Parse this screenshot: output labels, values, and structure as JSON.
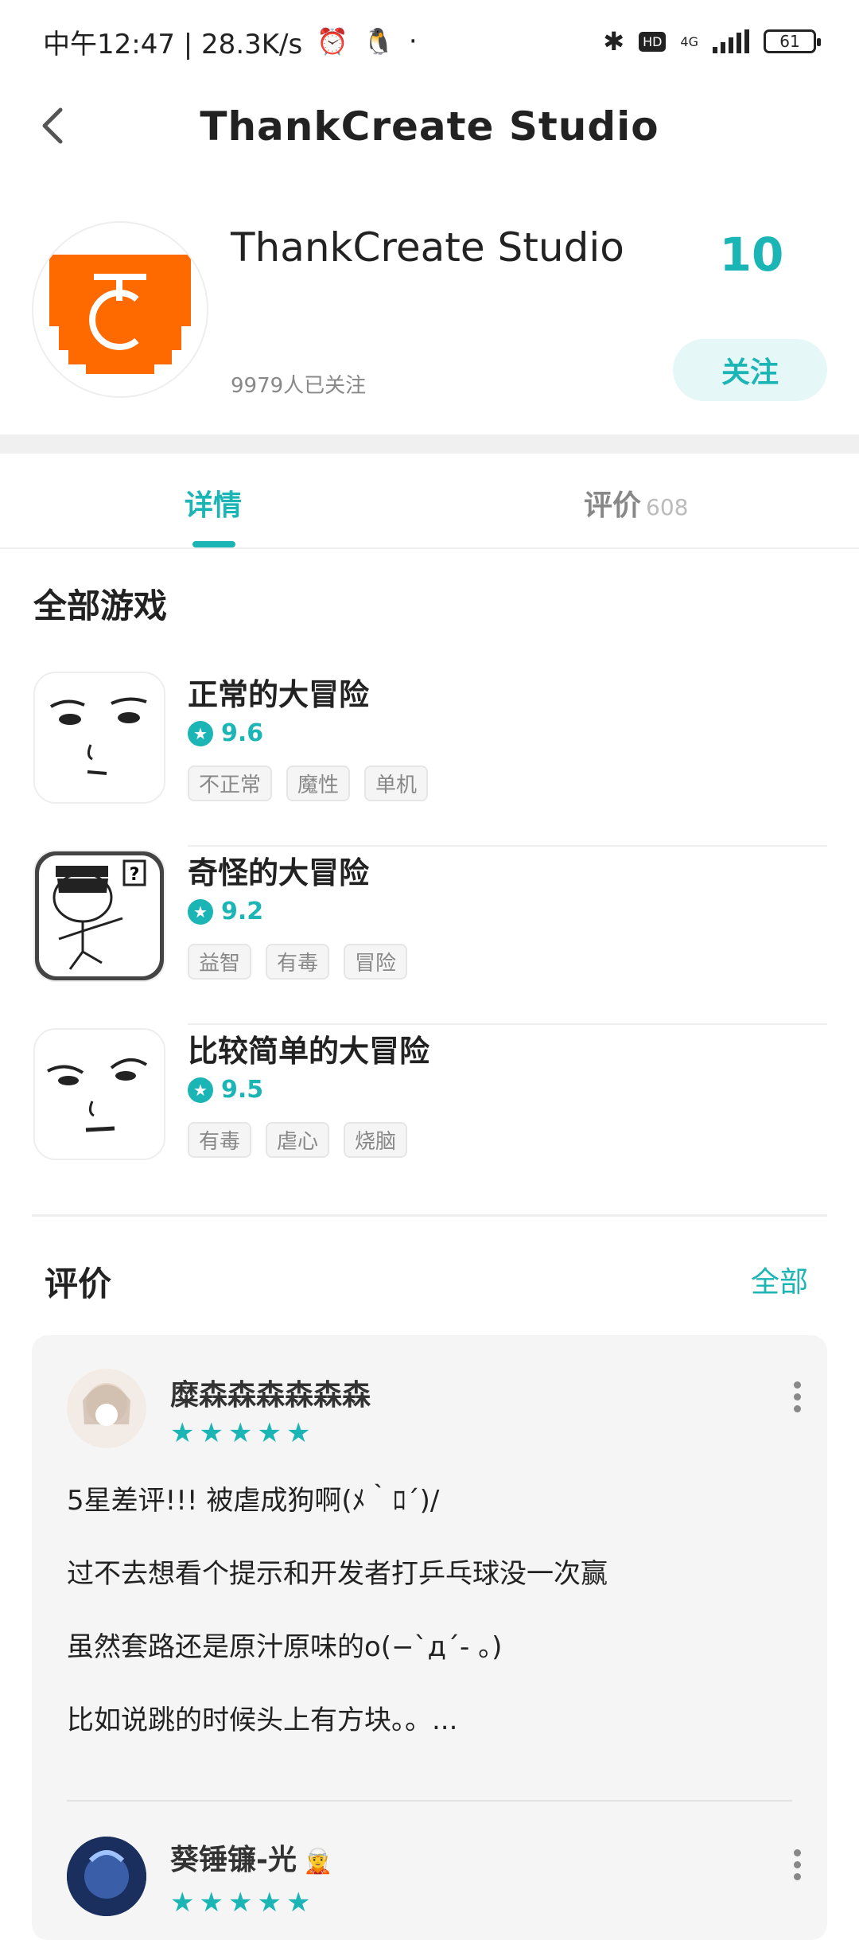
{
  "status_bar": {
    "time_speed": "中午12:47 | 28.3K/s",
    "dot": "·",
    "network": "4G",
    "hd": "HD",
    "battery": "61"
  },
  "nav": {
    "title": "ThankCreate  Studio"
  },
  "profile": {
    "name": "ThankCreate  Studio",
    "stat": "10",
    "followers": "9979人已关注",
    "follow_label": "关注"
  },
  "tabs": {
    "detail": "详情",
    "review": "评价",
    "review_count": "608"
  },
  "games_section": {
    "title": "全部游戏",
    "games": [
      {
        "name": "正常的大冒险",
        "score": "9.6",
        "tags": [
          "不正常",
          "魔性",
          "单机"
        ]
      },
      {
        "name": "奇怪的大冒险",
        "score": "9.2",
        "tags": [
          "益智",
          "有毒",
          "冒险"
        ]
      },
      {
        "name": "比较简单的大冒险",
        "score": "9.5",
        "tags": [
          "有毒",
          "虐心",
          "烧脑"
        ]
      }
    ]
  },
  "reviews": {
    "title": "评价",
    "all_label": "全部",
    "items": [
      {
        "user": "糜森森森森森森",
        "rating": 5,
        "lines": [
          "5星差评!!! 被虐成狗啊(ﾒ｀ﾛ´)/",
          "过不去想看个提示和开发者打乒乓球没一次赢",
          "虽然套路还是原汁原味的o(−`д´- 。)",
          "比如说跳的时候头上有方块。。..."
        ]
      },
      {
        "user": "葵锤镰-光",
        "rating": 5
      }
    ]
  },
  "colors": {
    "accent": "#1cb5b5",
    "logo_orange": "#ff6a00"
  }
}
